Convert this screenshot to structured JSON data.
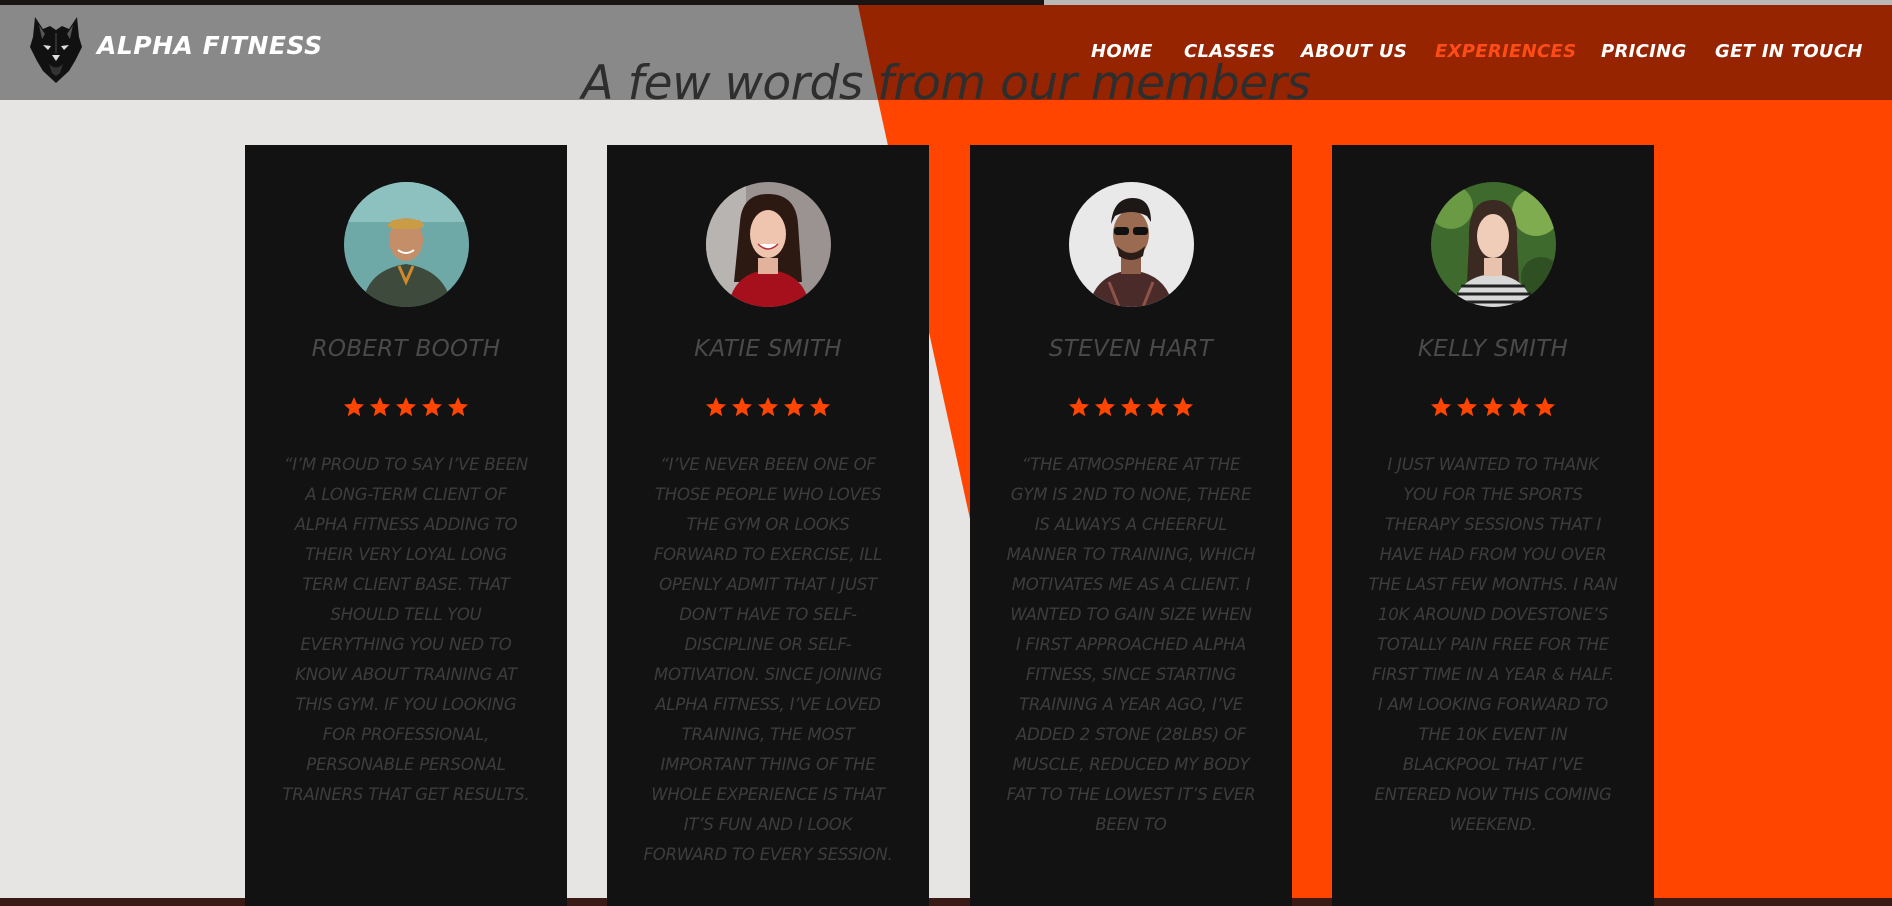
{
  "header": {
    "brand": "ALPHA FITNESS",
    "nav": [
      {
        "label": "HOME",
        "active": false
      },
      {
        "label": "CLASSES",
        "active": false
      },
      {
        "label": "ABOUT US",
        "active": false
      },
      {
        "label": "EXPERIENCES",
        "active": true
      },
      {
        "label": "PRICING",
        "active": false
      },
      {
        "label": "GET IN TOUCH",
        "active": false
      }
    ]
  },
  "section": {
    "title": "A few words from our members"
  },
  "testimonials": [
    {
      "name": "ROBERT BOOTH",
      "rating": 5,
      "quote": "“I’M PROUD TO SAY I’VE BEEN A LONG-TERM CLIENT OF ALPHA FITNESS ADDING TO THEIR VERY LOYAL LONG TERM CLIENT BASE. THAT SHOULD TELL YOU EVERYTHING YOU NED TO KNOW ABOUT TRAINING AT THIS GYM. IF YOU LOOKING FOR PROFESSIONAL, PERSONABLE PERSONAL TRAINERS THAT GET RESULTS."
    },
    {
      "name": "KATIE SMITH",
      "rating": 5,
      "quote": "“I’VE NEVER BEEN ONE OF THOSE PEOPLE WHO LOVES THE GYM OR LOOKS FORWARD TO EXERCISE, ILL OPENLY ADMIT THAT I JUST DON’T HAVE TO SELF-DISCIPLINE OR SELF-MOTIVATION. SINCE JOINING ALPHA FITNESS, I’VE LOVED TRAINING, THE MOST IMPORTANT THING OF THE WHOLE EXPERIENCE IS THAT IT’S FUN AND I LOOK FORWARD TO EVERY SESSION."
    },
    {
      "name": "STEVEN HART",
      "rating": 5,
      "quote": "“THE ATMOSPHERE AT THE GYM IS 2ND TO NONE, THERE IS ALWAYS A CHEERFUL MANNER TO TRAINING, WHICH MOTIVATES ME AS A CLIENT. I WANTED TO GAIN SIZE WHEN I FIRST APPROACHED ALPHA FITNESS, SINCE STARTING TRAINING A YEAR AGO, I’VE ADDED 2 STONE (28LBS) OF MUSCLE, REDUCED MY BODY FAT TO THE LOWEST IT’S EVER BEEN TO"
    },
    {
      "name": "KELLY SMITH",
      "rating": 5,
      "quote": "I JUST WANTED TO THANK YOU FOR THE SPORTS THERAPY SESSIONS THAT I HAVE HAD FROM YOU OVER THE LAST FEW MONTHS. I RAN 10K AROUND DOVESTONE’S TOTALLY PAIN FREE FOR THE FIRST TIME IN A YEAR & HALF. I AM LOOKING FORWARD TO THE 10K EVENT IN BLACKPOOL THAT I’VE ENTERED NOW THIS COMING WEEKEND."
    }
  ],
  "colors": {
    "accent": "#ff4500",
    "header_red": "#972400",
    "header_grey": "#878787",
    "card": "#121212",
    "background": "#e6e5e3"
  },
  "icons": [
    "wolf-logo-icon",
    "star-icon"
  ]
}
